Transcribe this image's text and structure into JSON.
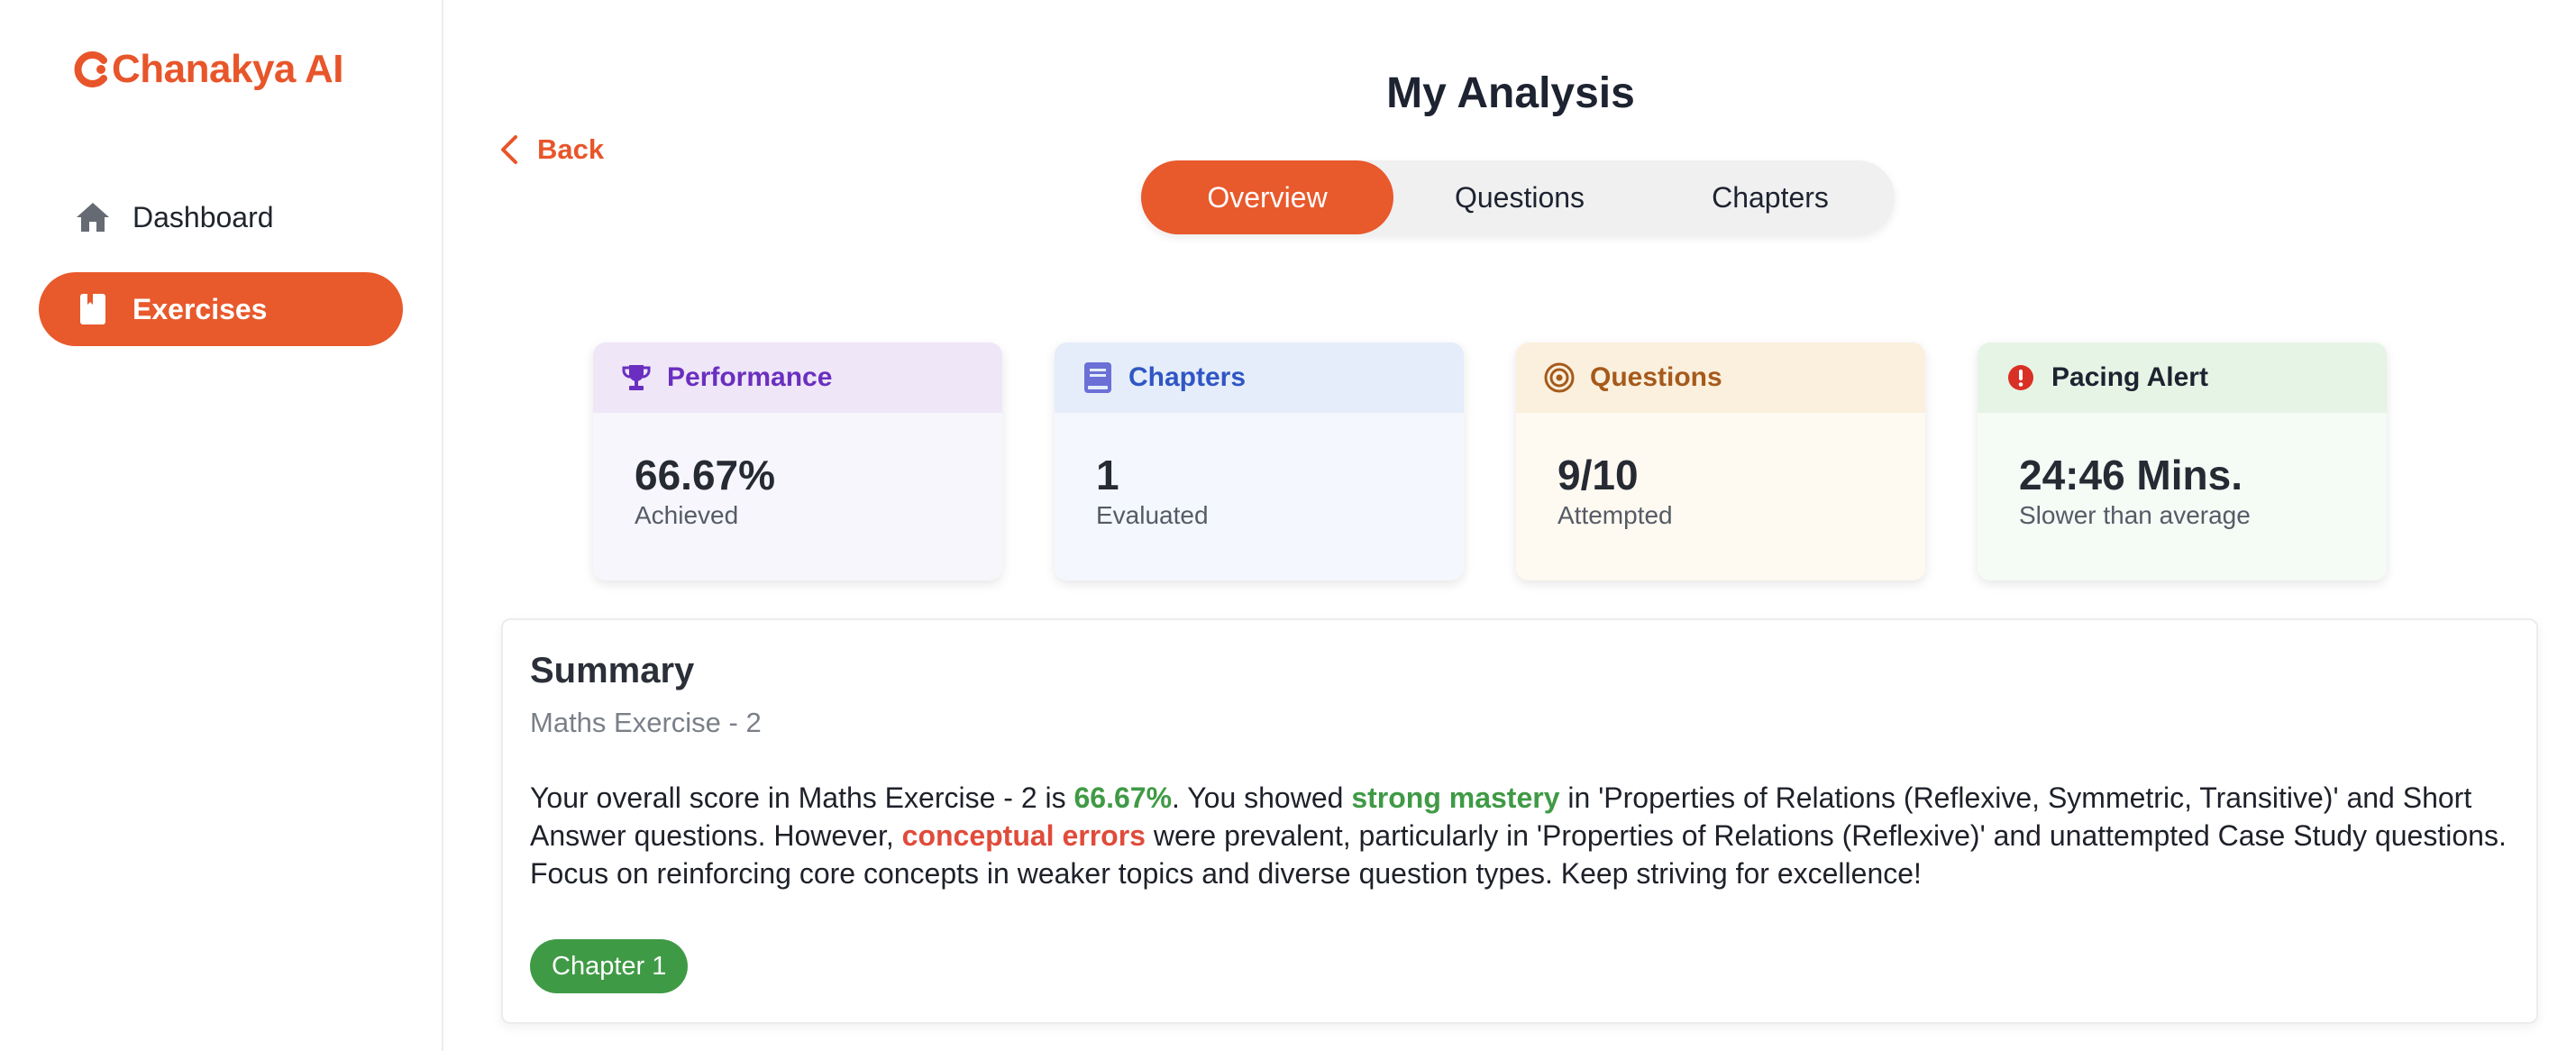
{
  "brand": {
    "name": "Chanakya AI",
    "accent": "#e8592c"
  },
  "sidebar": {
    "items": [
      {
        "label": "Dashboard",
        "icon": "home-icon",
        "active": false
      },
      {
        "label": "Exercises",
        "icon": "book-icon",
        "active": true
      }
    ]
  },
  "header": {
    "title": "My Analysis",
    "back_label": "Back",
    "tabs": [
      {
        "label": "Overview",
        "active": true
      },
      {
        "label": "Questions",
        "active": false
      },
      {
        "label": "Chapters",
        "active": false
      }
    ]
  },
  "cards": [
    {
      "title": "Performance",
      "icon": "trophy-icon",
      "value": "66.67%",
      "sub": "Achieved",
      "color": "#6a2fc0"
    },
    {
      "title": "Chapters",
      "icon": "book-icon",
      "value": "1",
      "sub": "Evaluated",
      "color": "#2f56c4"
    },
    {
      "title": "Questions",
      "icon": "target-icon",
      "value": "9/10",
      "sub": "Attempted",
      "color": "#a65a1b"
    },
    {
      "title": "Pacing Alert",
      "icon": "alert-icon",
      "value": "24:46 Mins.",
      "sub": "Slower than average",
      "color": "#d93025"
    }
  ],
  "summary": {
    "title": "Summary",
    "subtitle": "Maths Exercise - 2",
    "text_1": "Your overall score in Maths Exercise - 2 is ",
    "score": "66.67%",
    "text_2": ". You showed ",
    "strong": "strong mastery",
    "text_3": " in 'Properties of Relations (Reflexive, Symmetric, Transitive)' and Short Answer questions. However, ",
    "weak": "conceptual errors",
    "text_4": " were prevalent, particularly in 'Properties of Relations (Reflexive)' and unattempted Case Study questions. Focus on reinforcing core concepts in weaker topics and diverse question types. Keep striving for excellence!",
    "chip": "Chapter 1"
  }
}
